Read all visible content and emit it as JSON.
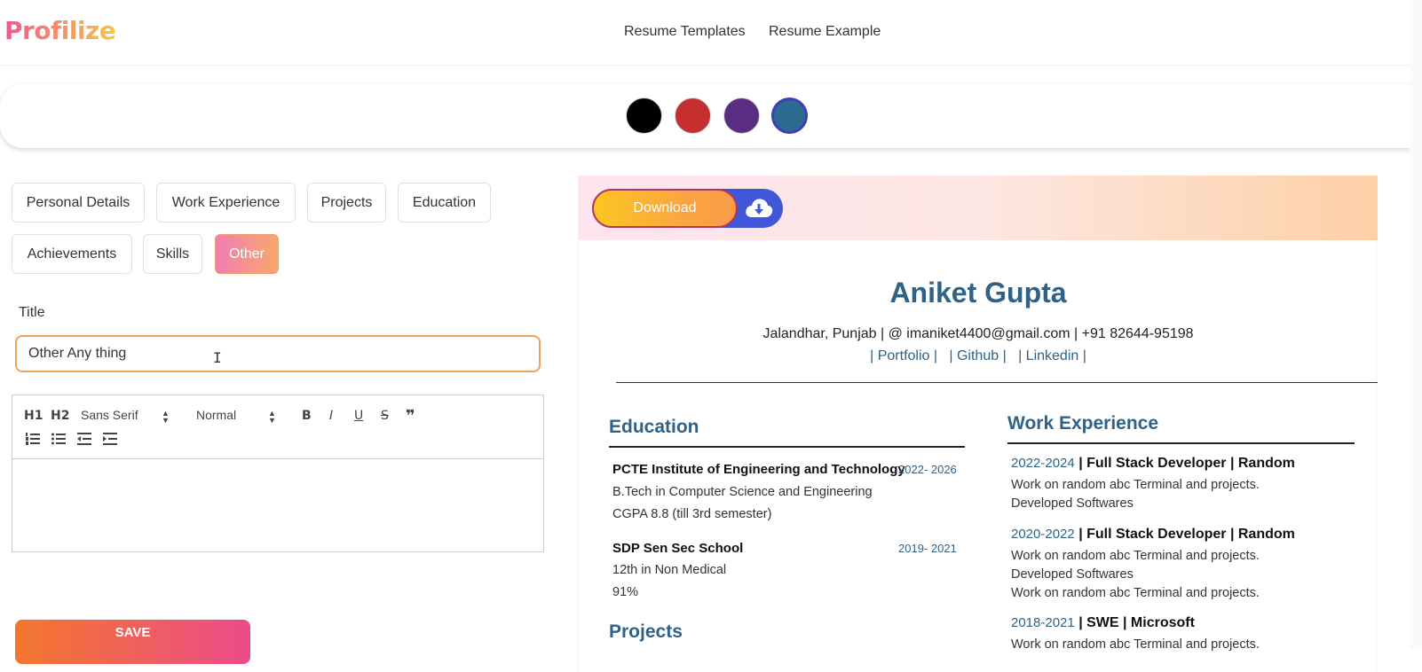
{
  "header": {
    "logo": "Profilize",
    "nav": [
      "Resume Templates",
      "Resume Example"
    ]
  },
  "palette": {
    "colors": [
      "#000000",
      "#c62f2f",
      "#5a2d82",
      "#2d6a8f"
    ],
    "selected": "#2d6a8f"
  },
  "tabs": [
    "Personal Details",
    "Work Experience",
    "Projects",
    "Education",
    "Achievements",
    "Skills",
    "Other"
  ],
  "active_tab": "Other",
  "form": {
    "title_label": "Title",
    "title_value": "Other Any thing",
    "toolbar": {
      "h1": "H1",
      "h2": "H2",
      "font": "Sans Serif",
      "size": "Normal",
      "bold": "B",
      "italic": "I",
      "underline": "U",
      "strike": "S",
      "quote": "❞"
    },
    "save_label": "SAVE"
  },
  "preview": {
    "download_label": "Download",
    "name": "Aniket Gupta",
    "contact": "Jalandhar, Punjab | @ imaniket4400@gmail.com | +91 82644-95198",
    "links": [
      "| Portfolio |",
      "| Github |",
      "| Linkedin |"
    ],
    "education": {
      "title": "Education",
      "items": [
        {
          "school": "PCTE Institute of Engineering and Technology",
          "years": "2022- 2026",
          "lines": [
            "B.Tech in Computer Science and Engineering",
            "CGPA 8.8 (till 3rd semester)"
          ]
        },
        {
          "school": "SDP Sen Sec School",
          "years": "2019- 2021",
          "lines": [
            "12th in Non Medical",
            "91%"
          ]
        }
      ]
    },
    "projects_title": "Projects",
    "work": {
      "title": "Work Experience",
      "items": [
        {
          "years": "2022-2024",
          "role": "| Full Stack Developer | Random",
          "lines": [
            "Work on random abc Terminal and projects.",
            "Developed Softwares"
          ]
        },
        {
          "years": "2020-2022",
          "role": "| Full Stack Developer | Random",
          "lines": [
            "Work on random abc Terminal and projects.",
            "Developed Softwares",
            "Work on random abc Terminal and projects."
          ]
        },
        {
          "years": "2018-2021",
          "role": "| SWE | Microsoft",
          "lines": [
            "Work on random abc Terminal and projects."
          ]
        }
      ]
    }
  }
}
